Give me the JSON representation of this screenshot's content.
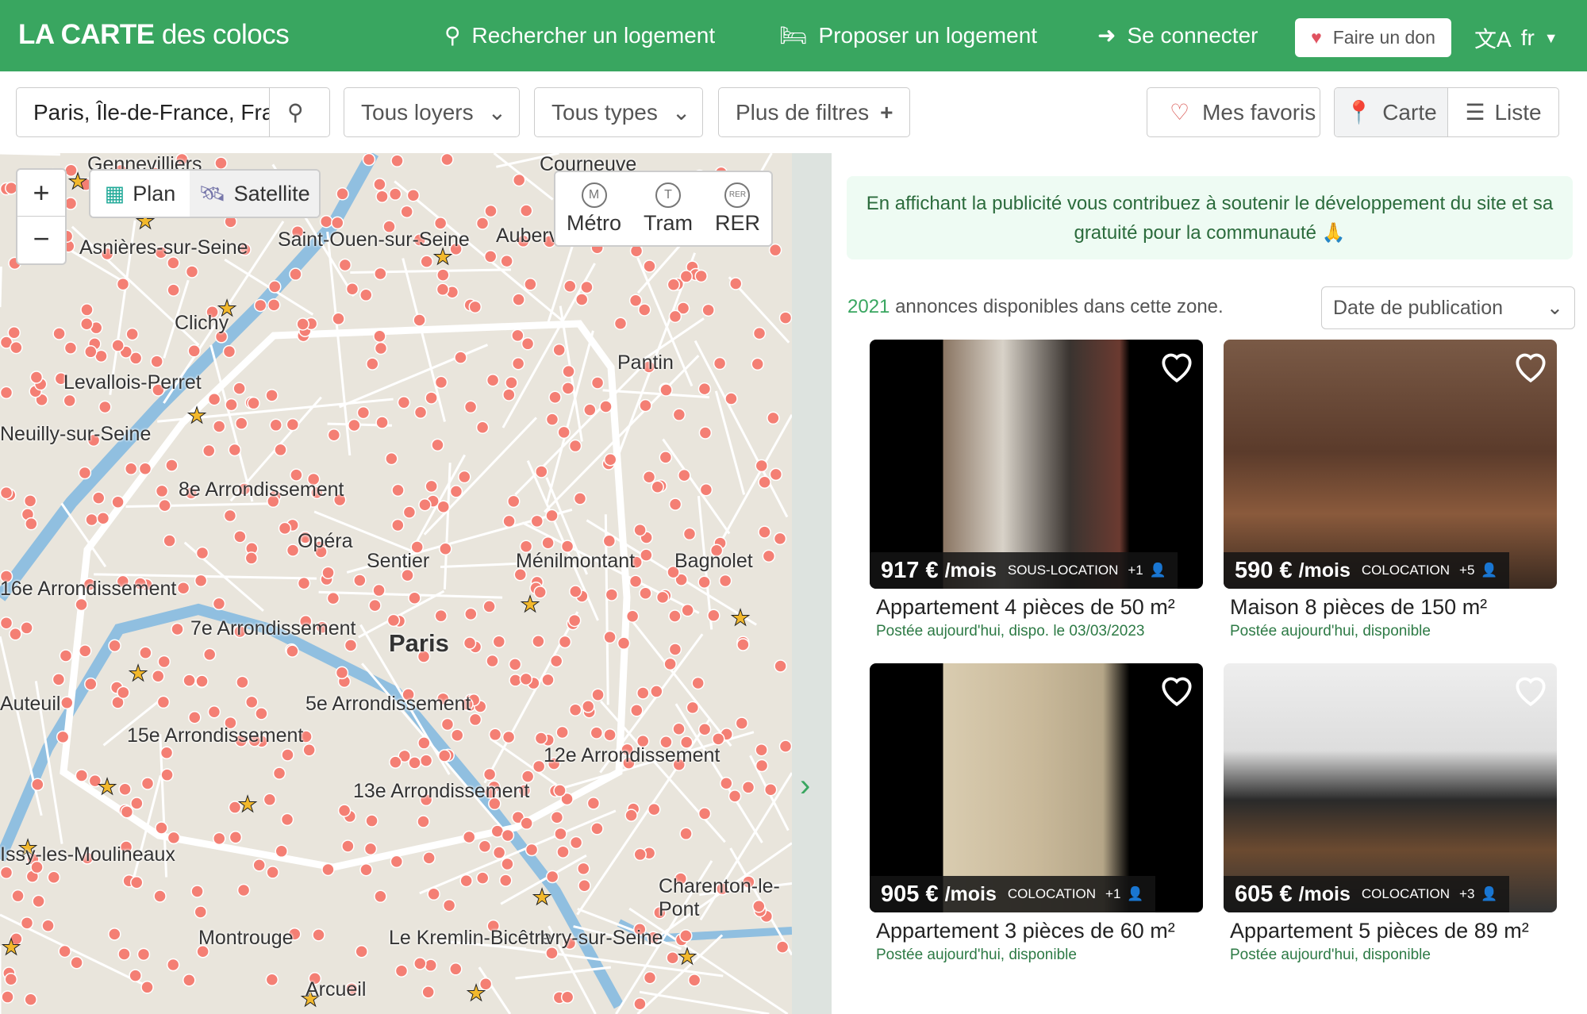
{
  "header": {
    "logo_bold": "LA CARTE",
    "logo_light": "des colocs",
    "search": "Rechercher un logement",
    "propose": "Proposer un logement",
    "login": "Se connecter",
    "donate": "Faire un don",
    "lang": "fr",
    "color": "#39a660"
  },
  "filters": {
    "location_value": "Paris, Île-de-France, Frar",
    "rent": "Tous loyers",
    "types": "Tous types",
    "more": "Plus de filtres",
    "favorites": "Mes favoris",
    "map_view": "Carte",
    "list_view": "Liste"
  },
  "map": {
    "plan": "Plan",
    "satellite": "Satellite",
    "transit": [
      "Métro",
      "Tram",
      "RER"
    ],
    "transit_icons": [
      "M",
      "T",
      "RER"
    ],
    "labels": [
      "Gennevilliers",
      "Courneuve",
      "Asnières-sur-Seine",
      "Saint-Ouen-sur-Seine",
      "Aubervilliers",
      "Clichy",
      "Levallois-Perret",
      "Pantin",
      "Neuilly-sur-Seine",
      "8e Arrondissement",
      "Opéra",
      "Sentier",
      "Ménilmontant",
      "Bagnolet",
      "16e Arrondissement",
      "7e Arrondissement",
      "Paris",
      "Auteuil",
      "5e Arrondissement",
      "15e Arrondissement",
      "13e Arrondissement",
      "12e Arrondissement",
      "Issy-les-Moulineaux",
      "Montrouge",
      "Le Kremlin-Bicêtre",
      "Ivry-sur-Seine",
      "Charenton-le-Pont",
      "Arcueil"
    ],
    "marker_color": "#f47f74"
  },
  "ad": {
    "text": "En affichant la publicité vous contribuez à soutenir le développement du site et sa gratuité pour la communauté 🙏"
  },
  "results": {
    "count": "2021",
    "text": "annonces disponibles dans cette zone.",
    "sort": "Date de publication"
  },
  "listings": [
    {
      "price": "917 €",
      "per": "/mois",
      "type": "SOUS-LOCATION",
      "people": "+1",
      "title": "Appartement 4 pièces de 50 m²",
      "sub": "Postée aujourd'hui, dispo. le 03/03/2023"
    },
    {
      "price": "590 €",
      "per": "/mois",
      "type": "COLOCATION",
      "people": "+5",
      "title": "Maison 8 pièces de 150 m²",
      "sub": "Postée aujourd'hui, disponible"
    },
    {
      "price": "905 €",
      "per": "/mois",
      "type": "COLOCATION",
      "people": "+1",
      "title": "Appartement 3 pièces de 60 m²",
      "sub": "Postée aujourd'hui, disponible"
    },
    {
      "price": "605 €",
      "per": "/mois",
      "type": "COLOCATION",
      "people": "+3",
      "title": "Appartement 5 pièces de 89 m²",
      "sub": "Postée aujourd'hui, disponible"
    }
  ]
}
